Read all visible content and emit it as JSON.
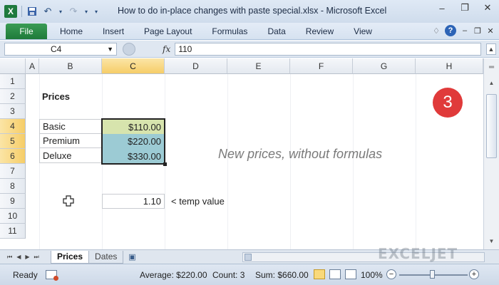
{
  "window": {
    "title": "How to do in-place changes with paste special.xlsx - Microsoft Excel",
    "app_icon": "excel-icon"
  },
  "ribbon": {
    "file_label": "File",
    "tabs": [
      "Home",
      "Insert",
      "Page Layout",
      "Formulas",
      "Data",
      "Review",
      "View"
    ]
  },
  "formula_bar": {
    "name_box": "C4",
    "fx_label": "fx",
    "value": "110"
  },
  "columns": [
    "A",
    "B",
    "C",
    "D",
    "E",
    "F",
    "G",
    "H"
  ],
  "selected_column": "C",
  "rows": [
    "1",
    "2",
    "3",
    "4",
    "5",
    "6",
    "7",
    "8",
    "9",
    "10",
    "11"
  ],
  "selected_rows": [
    "4",
    "5",
    "6"
  ],
  "sheet": {
    "heading": "Prices",
    "items": [
      {
        "label": "Basic",
        "price": "$110.00"
      },
      {
        "label": "Premium",
        "price": "$220.00"
      },
      {
        "label": "Deluxe",
        "price": "$330.00"
      }
    ],
    "temp_value": "1.10",
    "temp_note": "< temp value",
    "caption": "New prices, without formulas",
    "step_badge": "3"
  },
  "sheet_tabs": [
    {
      "name": "Prices",
      "active": true
    },
    {
      "name": "Dates",
      "active": false
    }
  ],
  "watermark": "EXCELJET",
  "status": {
    "ready": "Ready",
    "average": "Average: $220.00",
    "count": "Count: 3",
    "sum": "Sum: $660.00",
    "zoom": "100%",
    "zoom_minus": "−",
    "zoom_plus": "+"
  },
  "colors": {
    "accent_green": "#1f7a3a",
    "selected_header": "#f6cd68",
    "first_cell_fill": "#d7e4ad",
    "selection_fill": "#9ccbd4",
    "step_badge": "#e03a3a"
  }
}
